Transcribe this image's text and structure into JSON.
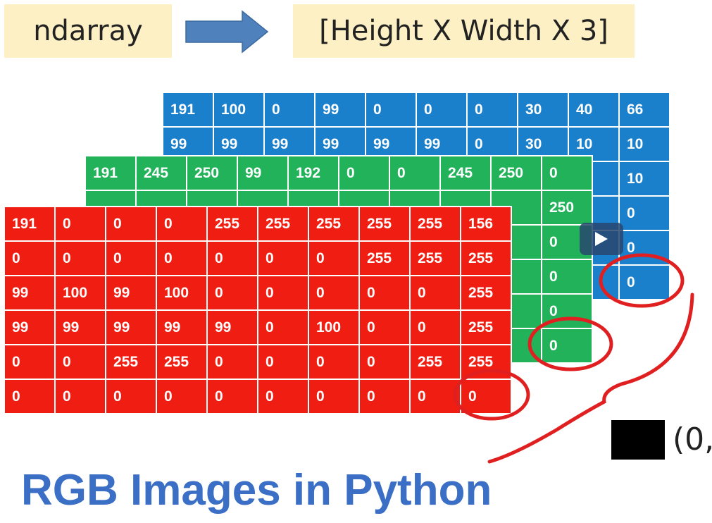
{
  "header": {
    "left_label": "ndarray",
    "right_label": "[Height X Width X 3]",
    "arrow_color": "#4f81bd"
  },
  "channels": {
    "blue": {
      "color": "#1b80cc",
      "rows": [
        [
          "191",
          "100",
          "0",
          "99",
          "0",
          "0",
          "0",
          "30",
          "40",
          "66"
        ],
        [
          "99",
          "99",
          "99",
          "99",
          "99",
          "99",
          "0",
          "30",
          "10",
          "10"
        ],
        [
          "",
          "",
          "",
          "",
          "",
          "",
          "",
          "",
          "",
          "10"
        ],
        [
          "",
          "",
          "",
          "",
          "",
          "",
          "",
          "",
          "",
          "0"
        ],
        [
          "",
          "",
          "",
          "",
          "",
          "",
          "",
          "",
          "",
          "0"
        ],
        [
          "",
          "",
          "",
          "",
          "",
          "",
          "",
          "",
          "",
          "0"
        ]
      ]
    },
    "green": {
      "color": "#22b25a",
      "rows": [
        [
          "191",
          "245",
          "250",
          "99",
          "192",
          "0",
          "0",
          "245",
          "250",
          "0"
        ],
        [
          "",
          "",
          "",
          "",
          "",
          "",
          "",
          "",
          "",
          "250"
        ],
        [
          "",
          "",
          "",
          "",
          "",
          "",
          "",
          "",
          "",
          "0"
        ],
        [
          "",
          "",
          "",
          "",
          "",
          "",
          "",
          "",
          "",
          "0"
        ],
        [
          "",
          "",
          "",
          "",
          "",
          "",
          "",
          "",
          "",
          "0"
        ],
        [
          "",
          "",
          "",
          "",
          "",
          "",
          "",
          "",
          "",
          "0"
        ]
      ]
    },
    "red": {
      "color": "#f01e12",
      "rows": [
        [
          "191",
          "0",
          "0",
          "0",
          "255",
          "255",
          "255",
          "255",
          "255",
          "156"
        ],
        [
          "0",
          "0",
          "0",
          "0",
          "0",
          "0",
          "0",
          "255",
          "255",
          "255"
        ],
        [
          "99",
          "100",
          "99",
          "100",
          "0",
          "0",
          "0",
          "0",
          "0",
          "255"
        ],
        [
          "99",
          "99",
          "99",
          "99",
          "99",
          "0",
          "100",
          "0",
          "0",
          "255"
        ],
        [
          "0",
          "0",
          "255",
          "255",
          "0",
          "0",
          "0",
          "0",
          "255",
          "255"
        ],
        [
          "0",
          "0",
          "0",
          "0",
          "0",
          "0",
          "0",
          "0",
          "0",
          "0"
        ]
      ]
    }
  },
  "annotation": {
    "swatch_color": "#000000",
    "tuple_text": "(0,",
    "highlight_color": "#e02020"
  },
  "title": {
    "text": "RGB Images in Python",
    "color": "#3b6fc6"
  },
  "video": {
    "play_icon": "play-icon"
  }
}
